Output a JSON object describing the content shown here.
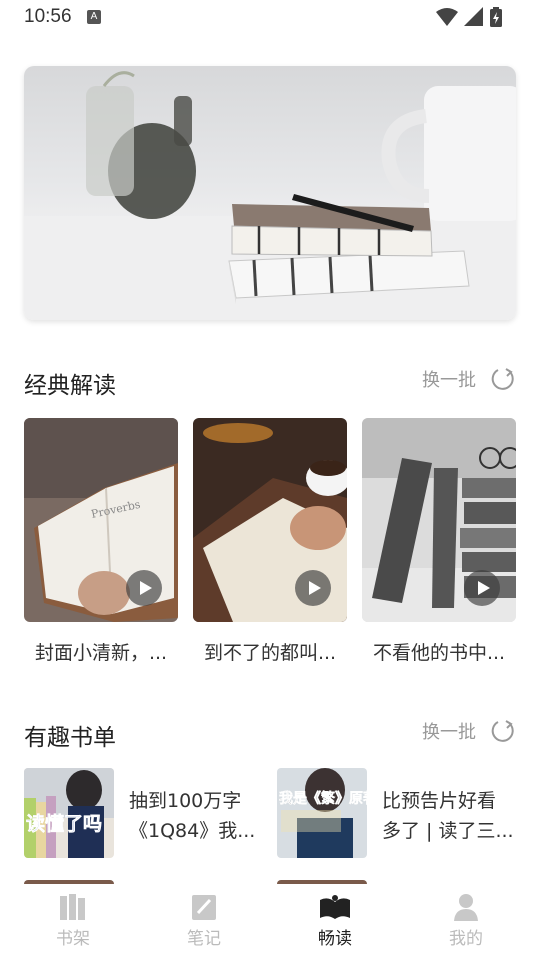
{
  "status_bar": {
    "time": "10:56",
    "a_badge": "A"
  },
  "sections": {
    "classic": {
      "title": "经典解读",
      "refresh_label": "换一批",
      "items": [
        {
          "caption": "封面小清新，..."
        },
        {
          "caption": "到不了的都叫..."
        },
        {
          "caption": "不看他的书中..."
        }
      ]
    },
    "booklist": {
      "title": "有趣书单",
      "refresh_label": "换一批",
      "items": [
        {
          "line1": "抽到100万字",
          "line2": "《1Q84》我...",
          "cover_text": "读懂了吗"
        },
        {
          "line1": "比预告片好看",
          "line2": "多了 | 读了三...",
          "cover_text": "我是《繁》原著党"
        }
      ]
    }
  },
  "nav": [
    {
      "label": "书架",
      "icon": "bookshelf-icon",
      "active": false
    },
    {
      "label": "笔记",
      "icon": "note-icon",
      "active": false
    },
    {
      "label": "畅读",
      "icon": "open-book-icon",
      "active": true
    },
    {
      "label": "我的",
      "icon": "profile-icon",
      "active": false
    }
  ],
  "colors": {
    "text_primary": "#222222",
    "text_muted": "#999999",
    "nav_inactive": "#bbbbbb"
  }
}
